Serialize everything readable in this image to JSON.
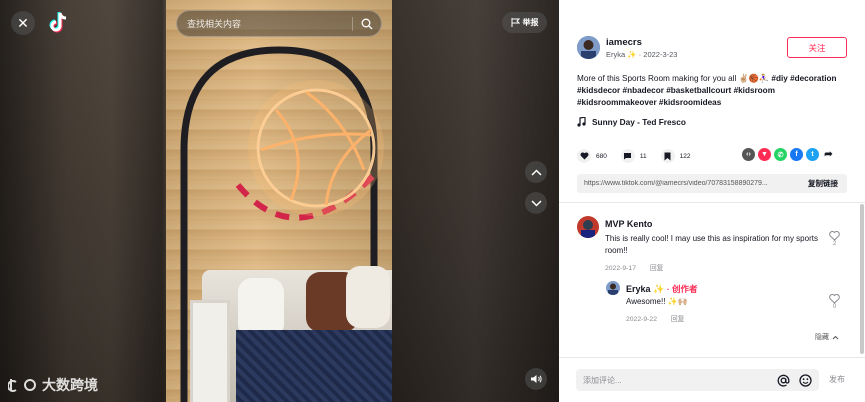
{
  "video": {
    "search_placeholder": "查找相关内容",
    "report_label": "举报",
    "watermark": "大数跨境"
  },
  "author": {
    "id": "iamecrs",
    "nickname": "Eryka ✨",
    "date": "2022-3-23",
    "follow_label": "关注"
  },
  "description": {
    "text": "More of this Sports Room making for you all ✌🏼🏀⛹🏼‍♀️",
    "tags": [
      "#diy",
      "#decoration",
      "#kidsdecor",
      "#nbadecor",
      "#basketballcourt",
      "#kidsroom",
      "#kidsroommakeover",
      "#kidsroomideas"
    ]
  },
  "music": "Sunny Day - Ted Fresco",
  "stats": {
    "likes": "680",
    "comments": "11",
    "saves": "122"
  },
  "share_icons": [
    "embed-icon",
    "share-red-icon",
    "whatsapp-icon",
    "facebook-icon",
    "twitter-icon",
    "share-arrow-icon"
  ],
  "link": {
    "url": "https://www.tiktok.com/@iamecrs/video/70783158890279...",
    "copy_label": "复制链接"
  },
  "comments": [
    {
      "name": "MVP Kento",
      "text": "This is really cool! I may use this as inspiration for my sports room!!",
      "date": "2022-9-17",
      "reply_label": "回复",
      "likes": "2"
    },
    {
      "name": "Eryka ✨",
      "creator_label": "· 创作者",
      "text": "Awesome!! ✨🙌🏼",
      "date": "2022-9-22",
      "reply_label": "回复",
      "likes": "0"
    }
  ],
  "hide_label": "隐藏",
  "footer": {
    "placeholder": "添加评论...",
    "post_label": "发布"
  },
  "colors": {
    "accent": "#fe2c55",
    "text": "#161823",
    "muted": "#8a8b91"
  }
}
